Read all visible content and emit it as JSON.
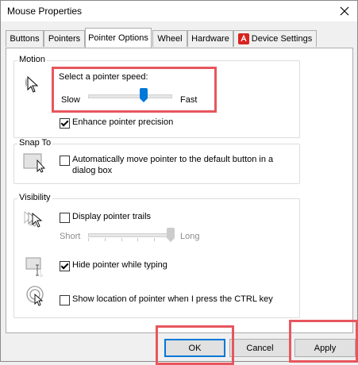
{
  "window": {
    "title": "Mouse Properties"
  },
  "tabs": [
    {
      "label": "Buttons"
    },
    {
      "label": "Pointers"
    },
    {
      "label": "Pointer Options",
      "active": true
    },
    {
      "label": "Wheel"
    },
    {
      "label": "Hardware"
    },
    {
      "label": "Device Settings"
    }
  ],
  "motion": {
    "group_label": "Motion",
    "speed_label": "Select a pointer speed:",
    "slow_label": "Slow",
    "fast_label": "Fast",
    "speed_fraction": 0.67,
    "enhance_label": "Enhance pointer precision",
    "enhance_checked": true
  },
  "snap": {
    "group_label": "Snap To",
    "auto_label_line1": "Automatically move pointer to the default button in a",
    "auto_label_line2": "dialog box",
    "auto_checked": false
  },
  "visibility": {
    "group_label": "Visibility",
    "trails_label": "Display pointer trails",
    "trails_checked": false,
    "short_label": "Short",
    "long_label": "Long",
    "trail_fraction": 1.0,
    "hide_label": "Hide pointer while typing",
    "hide_checked": true,
    "show_label": "Show location of pointer when I press the CTRL key",
    "show_checked": false
  },
  "buttons": {
    "ok": "OK",
    "cancel": "Cancel",
    "apply": "Apply"
  },
  "colors": {
    "highlight": "#e8565e",
    "accent": "#0078d7",
    "device_settings_icon": "#d8231f"
  }
}
